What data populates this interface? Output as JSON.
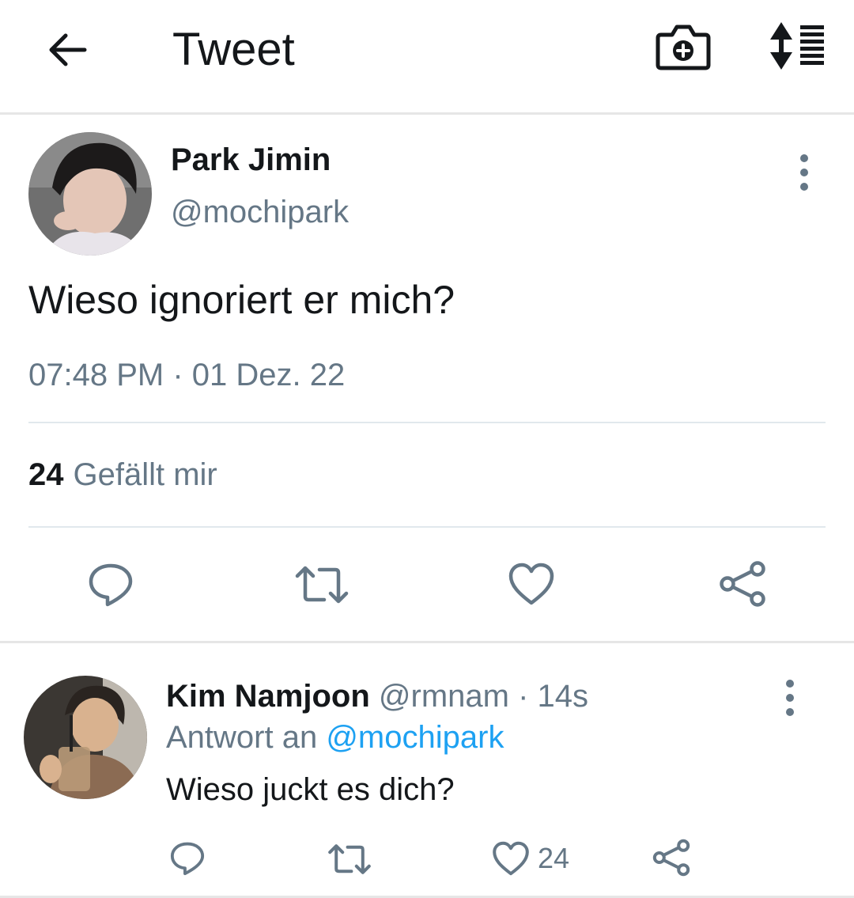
{
  "header": {
    "title": "Tweet",
    "icons": [
      "back-arrow-icon",
      "camera-plus-icon",
      "sort-icon"
    ]
  },
  "tweet": {
    "author_name": "Park Jimin",
    "author_handle": "@mochipark",
    "text": "Wieso ignoriert er mich?",
    "timestamp": "07:48 PM · 01 Dez. 22",
    "likes_count": "24",
    "likes_label": "Gefällt mir",
    "actions": [
      "reply-icon",
      "retweet-icon",
      "heart-icon",
      "share-icon"
    ]
  },
  "reply": {
    "author_name": "Kim Namjoon",
    "author_handle": "@rmnam",
    "separator": " · ",
    "time": "14s",
    "reply_prefix": "Antwort an ",
    "reply_mention": "@mochipark",
    "text": "Wieso juckt es dich?",
    "like_count": "24"
  },
  "colors": {
    "text": "#14171a",
    "secondary": "#657786",
    "accent": "#1da1f2",
    "divider": "#e1e8ed"
  }
}
